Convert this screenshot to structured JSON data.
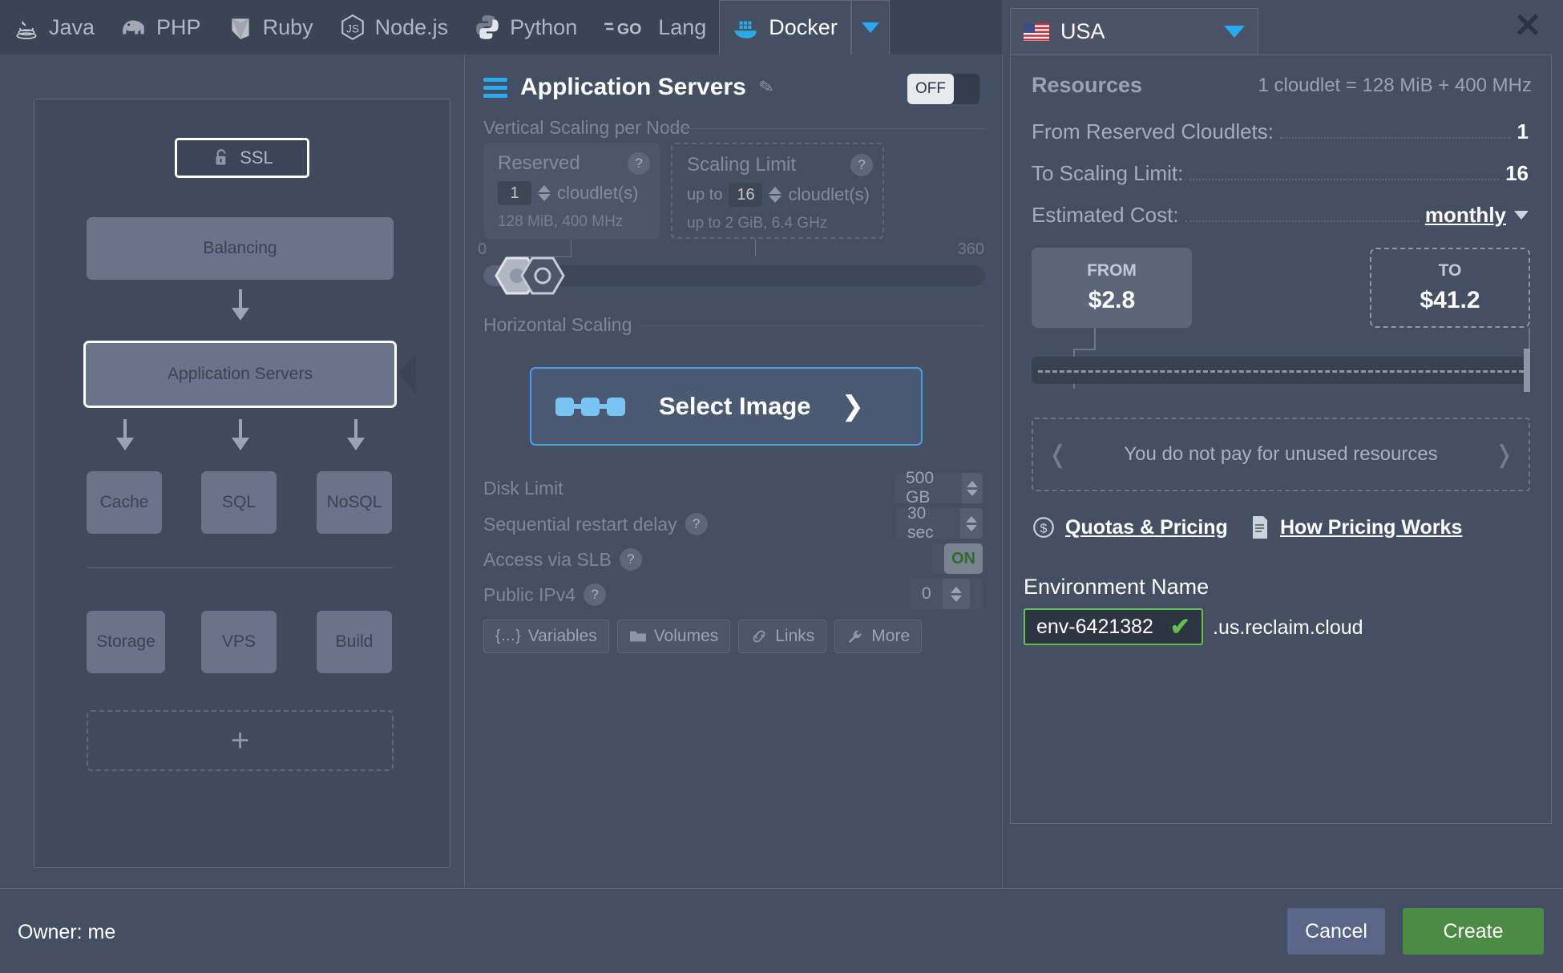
{
  "tabs": [
    {
      "label": "Java",
      "icon": "java-icon",
      "active": false
    },
    {
      "label": "PHP",
      "icon": "php-elephant-icon",
      "active": false
    },
    {
      "label": "Ruby",
      "icon": "ruby-gem-icon",
      "active": false
    },
    {
      "label": "Node.js",
      "icon": "nodejs-icon",
      "active": false
    },
    {
      "label": "Python",
      "icon": "python-icon",
      "active": false
    },
    {
      "label": "Lang",
      "icon": "go-lang-icon",
      "active": false
    },
    {
      "label": "Docker",
      "icon": "docker-whale-icon",
      "active": true
    }
  ],
  "tabbar": {
    "more_caret": "chevron-down-icon",
    "close": "close-icon"
  },
  "topology": {
    "ssl_chip": {
      "label": "SSL",
      "icon": "unlocked-padlock-icon"
    },
    "nodes": [
      {
        "label": "Balancing",
        "selected": false
      },
      {
        "label": "Application Servers",
        "selected": true
      },
      {
        "label": "Cache",
        "selected": false
      },
      {
        "label": "SQL",
        "selected": false
      },
      {
        "label": "NoSQL",
        "selected": false
      },
      {
        "label": "Storage",
        "selected": false
      },
      {
        "label": "VPS",
        "selected": false
      },
      {
        "label": "Build",
        "selected": false
      }
    ],
    "add_label": "+"
  },
  "middle": {
    "title": "Application Servers",
    "menu_icon": "hamburger-icon",
    "edit_icon": "pencil-icon",
    "power_toggle": "OFF",
    "vertical_section": "Vertical Scaling per Node",
    "reserved": {
      "title": "Reserved",
      "value": "1",
      "unit": "cloudlet(s)",
      "note": "128 MiB, 400 MHz",
      "help": "?"
    },
    "scaling_limit": {
      "title": "Scaling Limit",
      "prefix": "up to",
      "value": "16",
      "unit": "cloudlet(s)",
      "note": "up to 2 GiB, 6.4 GHz",
      "help": "?"
    },
    "slider": {
      "min_label": "0",
      "max_label": "360"
    },
    "horizontal_section": "Horizontal Scaling",
    "select_image": {
      "label": "Select Image",
      "icon": "containers-icon",
      "arrow": "chevron-right-icon"
    },
    "fields": [
      {
        "label": "Disk Limit",
        "value": "500 GB",
        "help": false,
        "type": "stepper"
      },
      {
        "label": "Sequential restart delay",
        "value": "30  sec",
        "help": true,
        "type": "stepper"
      },
      {
        "label": "Access via SLB",
        "value": "ON",
        "help": true,
        "type": "toggle"
      },
      {
        "label": "Public IPv4",
        "value": "0",
        "help": true,
        "type": "stepper"
      }
    ],
    "chips": [
      {
        "label": "Variables",
        "icon": "braces-icon"
      },
      {
        "label": "Volumes",
        "icon": "folder-icon"
      },
      {
        "label": "Links",
        "icon": "link-icon"
      },
      {
        "label": "More",
        "icon": "wrench-icon"
      }
    ]
  },
  "right": {
    "region": {
      "label": "USA",
      "flag": "usa-flag-icon",
      "caret": "chevron-down-icon"
    },
    "resources_title": "Resources",
    "resources_sub": "1 cloudlet = 128 MiB + 400 MHz",
    "rows": [
      {
        "key": "From Reserved Cloudlets:",
        "value": "1"
      },
      {
        "key": "To Scaling Limit:",
        "value": "16"
      }
    ],
    "estimated_cost": {
      "key": "Estimated Cost:",
      "period": "monthly",
      "caret": "chevron-down-icon"
    },
    "cost_from": {
      "label": "FROM",
      "value": "$2.8"
    },
    "cost_to": {
      "label": "TO",
      "value": "$41.2"
    },
    "tip": {
      "text": "You do not pay for unused resources",
      "prev": "chevron-left-icon",
      "next": "chevron-right-icon"
    },
    "links": [
      {
        "label": "Quotas & Pricing",
        "icon": "dollar-circle-icon"
      },
      {
        "label": "How Pricing Works",
        "icon": "document-icon"
      }
    ],
    "env": {
      "label": "Environment Name",
      "value": "env-6421382",
      "placeholder": "env-name",
      "check": "✔",
      "suffix": ".us.reclaim.cloud"
    }
  },
  "footer": {
    "owner": "Owner: me",
    "cancel": "Cancel",
    "create": "Create"
  },
  "colors": {
    "accent": "#29aaf2",
    "create_green": "#4b8b43",
    "valid_green": "#5fc24a",
    "panel_bg": "#454f63",
    "tabbar_bg": "#3b4456"
  }
}
